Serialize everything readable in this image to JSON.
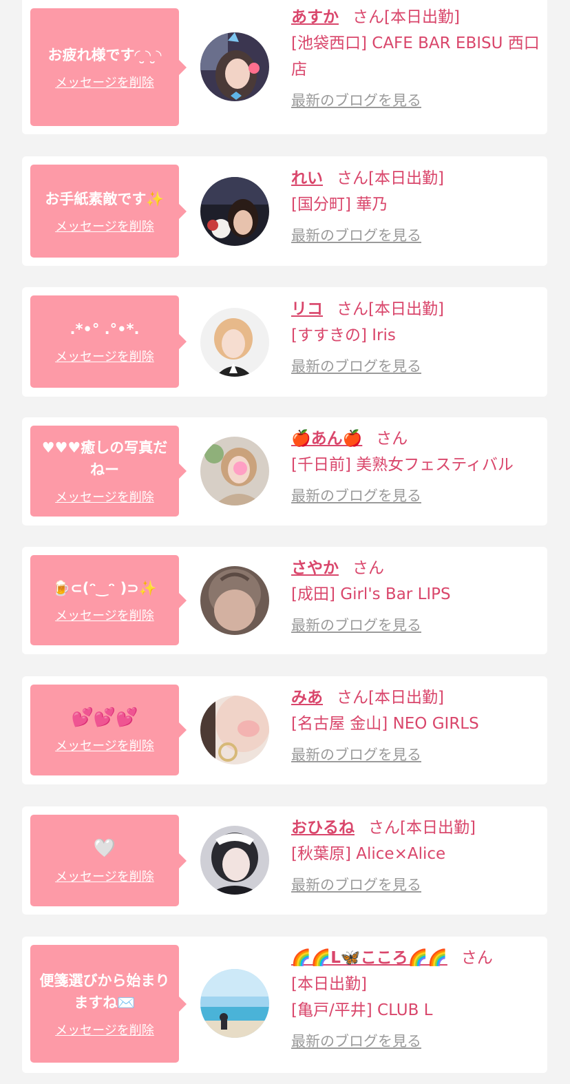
{
  "colors": {
    "page_background": "#f3f3f3",
    "card_background": "#ffffff",
    "bubble_background": "#fd9aa7",
    "accent_pink": "#d9466b",
    "link_gray": "#9a9a9a"
  },
  "delete_label": "メッセージを削除",
  "blog_label": "最新のブログを見る",
  "honorific": "さん",
  "messages": [
    {
      "message": "お疲れ様です◜ ̮◝ ̮◝",
      "cast_name": "あすか",
      "status": "[本日出勤]",
      "shop": "[池袋西口] CAFE BAR EBISU 西口店"
    },
    {
      "message": "お手紙素敵です✨",
      "cast_name": "れい",
      "status": "[本日出勤]",
      "shop": "[国分町] 華乃"
    },
    {
      "message": ".*•° .°•*.",
      "cast_name": "リコ",
      "status": "[本日出勤]",
      "shop": "[すすきの] Iris"
    },
    {
      "message": "♥♥♥癒しの写真だねー",
      "cast_name": "🍎あん🍎",
      "status": "",
      "shop": "[千日前] 美熟女フェスティバル"
    },
    {
      "message": "🍺⊂(ᵔ‿ᵔ )⊃✨",
      "cast_name": "さやか",
      "status": "",
      "shop": "[成田] Girl's Bar LIPS"
    },
    {
      "message": "💕💕💕",
      "cast_name": "みあ",
      "status": "[本日出勤]",
      "shop": "[名古屋 金山] NEO GIRLS"
    },
    {
      "message": "🤍",
      "cast_name": "おひるね",
      "status": "[本日出勤]",
      "shop": "[秋葉原] Alice×Alice"
    },
    {
      "message": "便箋選びから始まりますね✉️",
      "cast_name": "🌈🌈L🦋こころ🌈🌈",
      "status": "[本日出勤]",
      "shop": "[亀戸/平井] CLUB L"
    }
  ]
}
